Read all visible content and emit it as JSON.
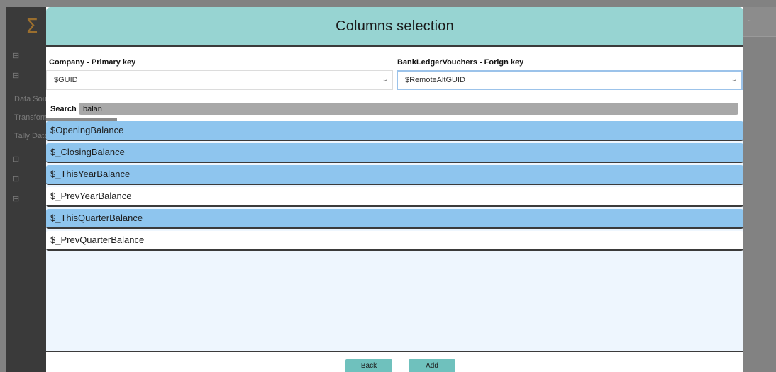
{
  "background": {
    "logo_icon": "sigma-icon",
    "sidebar_items": [
      "Data Sou",
      "Transform Data",
      "Tally Data"
    ]
  },
  "modal": {
    "title": "Columns selection",
    "primary_key": {
      "label": "Company - Primary key",
      "value": "$GUID"
    },
    "foreign_key": {
      "label": "BankLedgerVouchers - Forign key",
      "value": "$RemoteAltGUID"
    },
    "search": {
      "label": "Search",
      "value": "balan"
    },
    "columns": [
      {
        "label": "$OpeningBalance",
        "selected": true
      },
      {
        "label": "$_ClosingBalance",
        "selected": true
      },
      {
        "label": "$_ThisYearBalance",
        "selected": true
      },
      {
        "label": "$_PrevYearBalance",
        "selected": false
      },
      {
        "label": "$_ThisQuarterBalance",
        "selected": true
      },
      {
        "label": "$_PrevQuarterBalance",
        "selected": false
      }
    ],
    "buttons": {
      "back": "Back",
      "add": "Add"
    }
  },
  "colors": {
    "header": "#97d4d2",
    "selected_row": "#8ec5ee",
    "button": "#6fc1bd",
    "list_background": "#eef6fe"
  }
}
